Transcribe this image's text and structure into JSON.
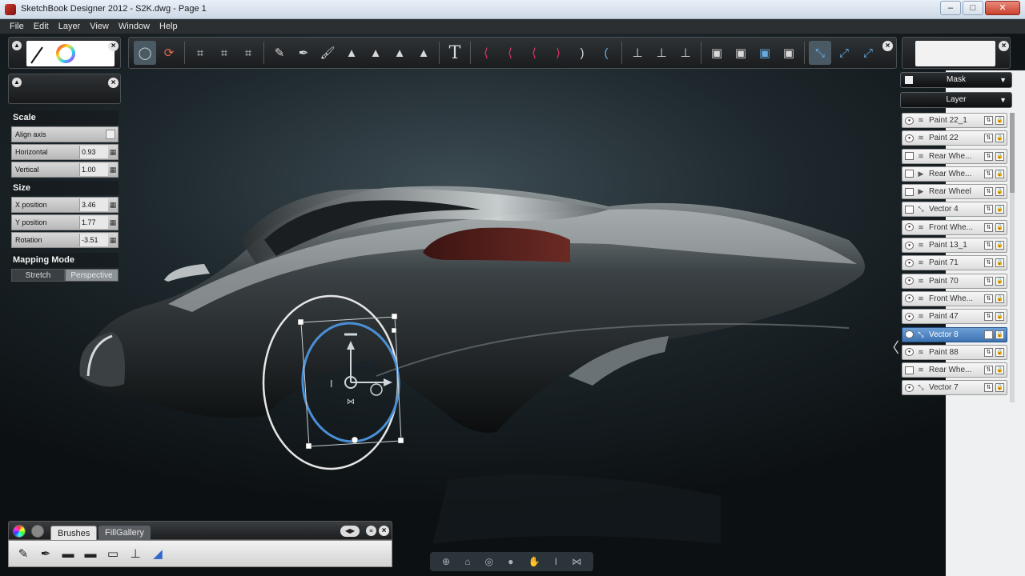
{
  "window": {
    "title": "SketchBook Designer 2012 - S2K.dwg - Page 1",
    "buttons": {
      "minimize": "–",
      "maximize": "□",
      "close": "✕"
    }
  },
  "menu": [
    "File",
    "Edit",
    "Layer",
    "View",
    "Window",
    "Help"
  ],
  "transform_panel": {
    "scale_heading": "Scale",
    "align_axis": "Align axis",
    "horizontal_label": "Horizontal",
    "horizontal_value": "0.93",
    "vertical_label": "Vertical",
    "vertical_value": "1.00",
    "size_heading": "Size",
    "xpos_label": "X position",
    "xpos_value": "3.46",
    "ypos_label": "Y position",
    "ypos_value": "1.77",
    "rotation_label": "Rotation",
    "rotation_value": "-3.51",
    "mapping_heading": "Mapping Mode",
    "stretch": "Stretch",
    "perspective": "Perspective"
  },
  "right_panel": {
    "mask": "Mask",
    "layer": "Layer",
    "layers": [
      {
        "name": "Paint 22_1",
        "kind": "paint",
        "visible": true
      },
      {
        "name": "Paint 22",
        "kind": "paint",
        "visible": true
      },
      {
        "name": "Rear Whe...",
        "kind": "paint",
        "visible": false
      },
      {
        "name": "Rear Whe...",
        "kind": "group",
        "visible": false
      },
      {
        "name": "Rear Wheel",
        "kind": "group",
        "visible": false
      },
      {
        "name": "Vector 4",
        "kind": "vector",
        "visible": false
      },
      {
        "name": "Front Whe...",
        "kind": "paint",
        "visible": true
      },
      {
        "name": "Paint 13_1",
        "kind": "paint",
        "visible": true
      },
      {
        "name": "Paint 71",
        "kind": "paint",
        "visible": true
      },
      {
        "name": "Paint 70",
        "kind": "paint",
        "visible": true
      },
      {
        "name": "Front Whe...",
        "kind": "paint",
        "visible": true
      },
      {
        "name": "Paint 47",
        "kind": "paint",
        "visible": true
      },
      {
        "name": "Vector 8",
        "kind": "vector",
        "visible": true,
        "selected": true
      },
      {
        "name": "Paint 88",
        "kind": "paint",
        "visible": true
      },
      {
        "name": "Rear Whe...",
        "kind": "paint",
        "visible": false
      },
      {
        "name": "Vector 7",
        "kind": "vector",
        "visible": true
      }
    ]
  },
  "brush_palette": {
    "tab_brushes": "Brushes",
    "tab_fillgallery": "FillGallery"
  },
  "colors": {
    "accent": "#3e73b3",
    "selection_ellipse": "#4a8fd6",
    "taillight": "#5a1f1c"
  }
}
